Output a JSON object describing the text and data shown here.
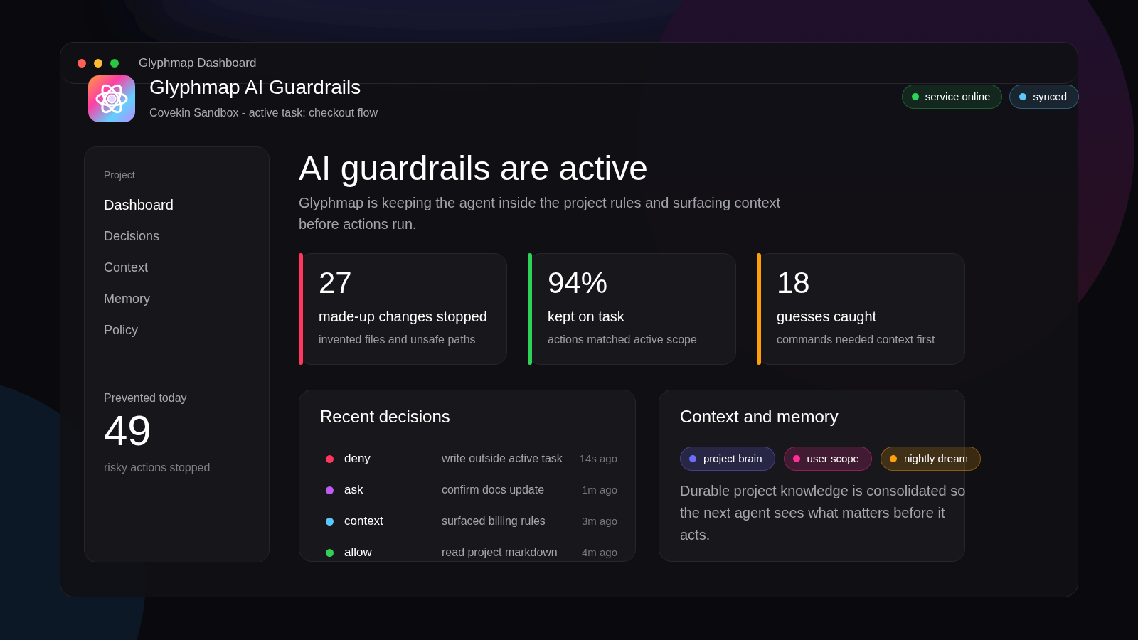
{
  "window": {
    "title": "Glyphmap Dashboard"
  },
  "header": {
    "title": "Glyphmap AI Guardrails",
    "subtitle": "Covekin Sandbox - active task: checkout flow",
    "badges": [
      {
        "label": "service online",
        "color": "#30d158"
      },
      {
        "label": "synced",
        "color": "#5ac8fa"
      }
    ]
  },
  "sidebar": {
    "section_label": "Project",
    "items": [
      {
        "label": "Dashboard",
        "selected": true
      },
      {
        "label": "Decisions",
        "selected": false
      },
      {
        "label": "Context",
        "selected": false
      },
      {
        "label": "Memory",
        "selected": false
      },
      {
        "label": "Policy",
        "selected": false
      }
    ],
    "summary": {
      "label": "Prevented today",
      "value": "49",
      "caption": "risky actions stopped"
    }
  },
  "main": {
    "heading": "AI guardrails are active",
    "description": "Glyphmap is keeping the agent inside the project rules and surfacing context before actions run.",
    "stats": [
      {
        "value": "27",
        "label": "made-up changes stopped",
        "caption": "invented files and unsafe paths",
        "color": "#ff375f"
      },
      {
        "value": "94%",
        "label": "kept on task",
        "caption": "actions matched active scope",
        "color": "#30d158"
      },
      {
        "value": "18",
        "label": "guesses caught",
        "caption": "commands needed context first",
        "color": "#ff9f0a"
      }
    ]
  },
  "recent_decisions": {
    "title": "Recent decisions",
    "rows": [
      {
        "decision": "deny",
        "detail": "write outside active task",
        "time": "14s ago",
        "color": "#ff375f"
      },
      {
        "decision": "ask",
        "detail": "confirm docs update",
        "time": "1m ago",
        "color": "#bf5af2"
      },
      {
        "decision": "context",
        "detail": "surfaced billing rules",
        "time": "3m ago",
        "color": "#5ac8fa"
      },
      {
        "decision": "allow",
        "detail": "read project markdown",
        "time": "4m ago",
        "color": "#30d158"
      }
    ]
  },
  "context_memory": {
    "title": "Context and memory",
    "tags": [
      {
        "label": "project brain",
        "color": "#6e6cff"
      },
      {
        "label": "user scope",
        "color": "#ff2d95"
      },
      {
        "label": "nightly dream",
        "color": "#ff9f0a"
      }
    ],
    "text": "Durable project knowledge is consolidated so the next agent sees what matters before it acts."
  }
}
